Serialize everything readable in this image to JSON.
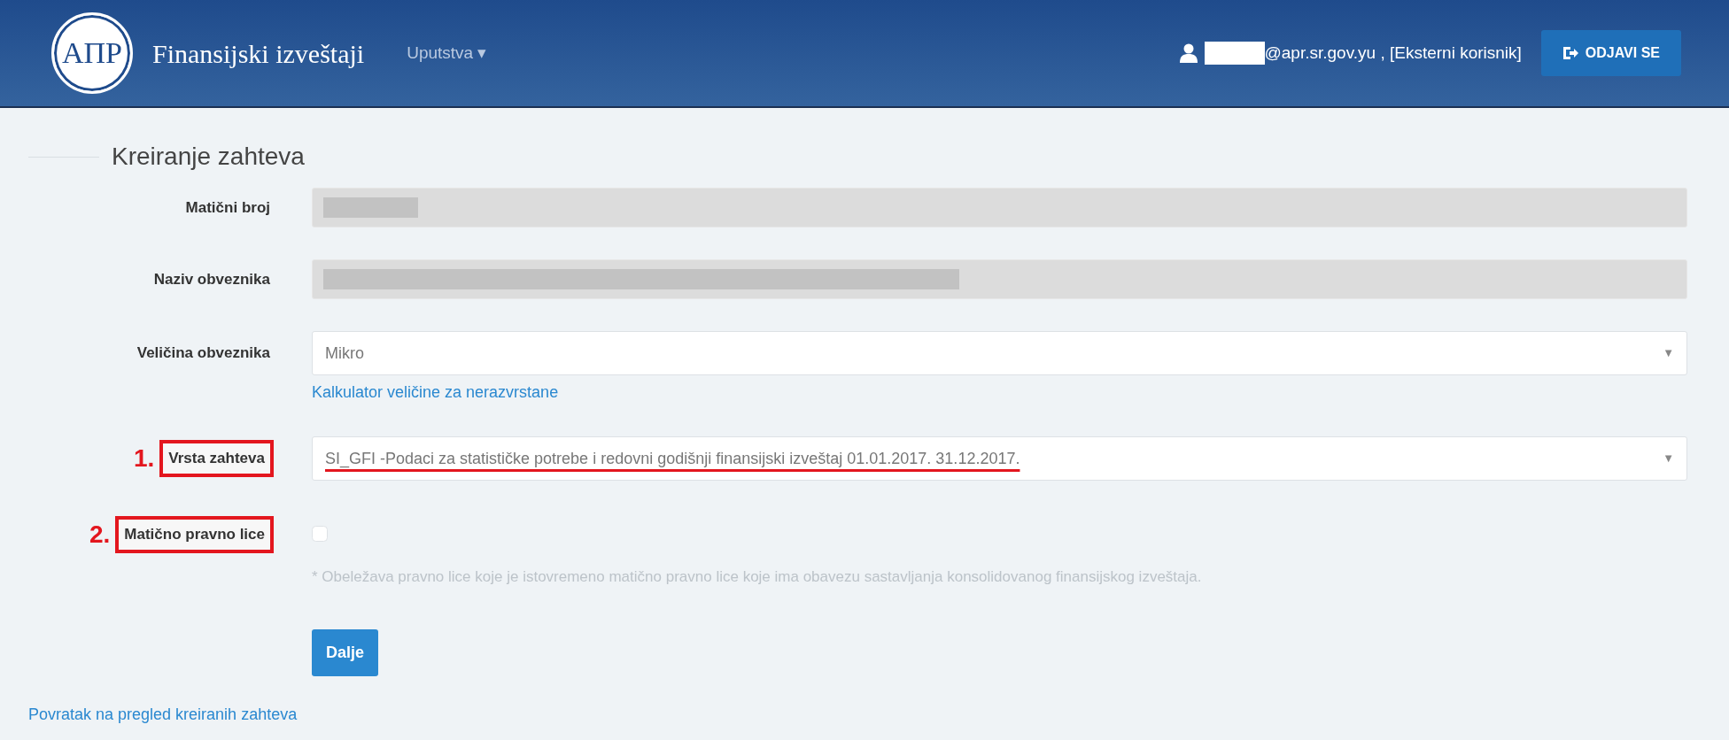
{
  "header": {
    "logo_text": "АПР",
    "title": "Finansijski izveštaji",
    "menu": {
      "label": "Uputstva",
      "caret": "▾"
    },
    "user": {
      "email_redacted": true,
      "email_suffix": "@apr.sr.gov.yu , [Eksterni korisnik]"
    },
    "logout_button": "ODJAVI SE"
  },
  "form": {
    "legend": "Kreiranje zahteva",
    "fields": [
      {
        "kind": "readonly",
        "label": "Matični broj"
      },
      {
        "kind": "readonly",
        "label": "Naziv obveznika"
      },
      {
        "kind": "select",
        "label": "Veličina obveznika",
        "value": "Mikro",
        "caret": "▼",
        "link": "Kalkulator veličine za nerazvrstane"
      },
      {
        "kind": "select",
        "label": "Vrsta zahteva",
        "value": "SI_GFI -Podaci za statističke potrebe i redovni godišnji finansijski izveštaj 01.01.2017. 31.12.2017.",
        "caret": "▼",
        "marker": "1.",
        "boxed": true,
        "underlined": true
      },
      {
        "kind": "checkbox",
        "label": "Matično pravno lice",
        "checked": false,
        "marker": "2.",
        "boxed": true,
        "note": "* Obeležava pravno lice koje je istovremeno matično pravno lice koje ima obavezu sastavljanja konsolidovanog finansijskog izveštaja."
      }
    ],
    "submit_button": "Dalje"
  },
  "back_link": "Povratak na pregled kreiranih zahteva"
}
